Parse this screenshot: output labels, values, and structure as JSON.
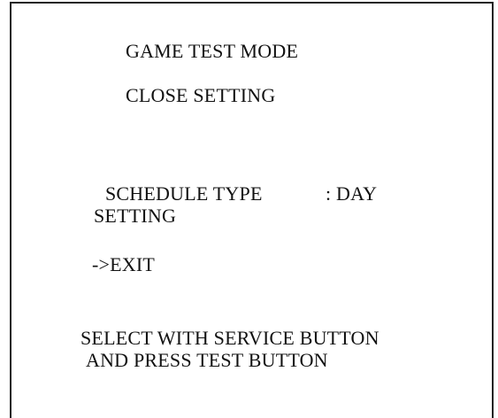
{
  "screen": {
    "title": "GAME TEST MODE",
    "subtitle": "CLOSE SETTING"
  },
  "menu": {
    "schedule_label": "SCHEDULE TYPE",
    "schedule_value": ": DAY",
    "setting_label": "SETTING",
    "exit_label": "->EXIT"
  },
  "footer": {
    "line1": "SELECT WITH SERVICE BUTTON",
    "line2": "AND PRESS TEST BUTTON"
  }
}
